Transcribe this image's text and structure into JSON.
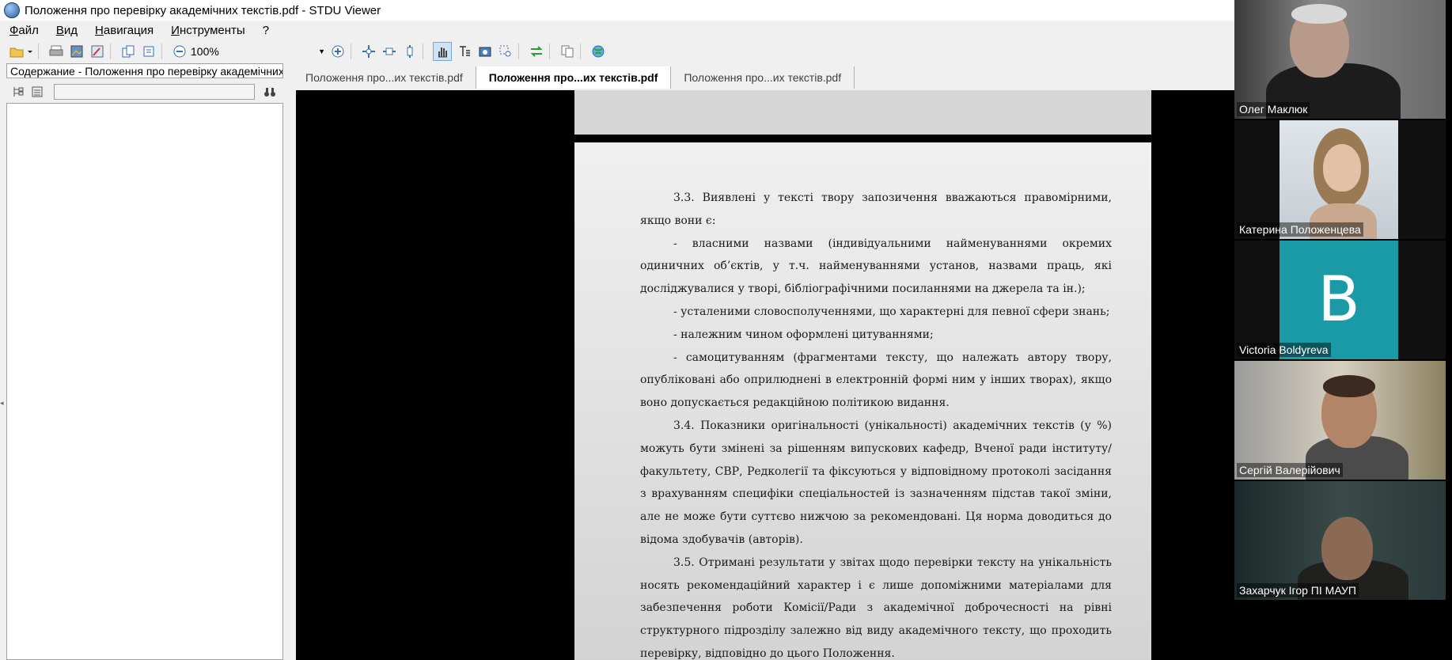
{
  "window": {
    "title": "Положення про перевірку академічних текстів.pdf - STDU Viewer"
  },
  "menu": [
    "Файл",
    "Вид",
    "Навигация",
    "Инструменты",
    "?"
  ],
  "toolbar": {
    "zoom": "100%"
  },
  "sidebar": {
    "header": "Содержание - Положення про перевірку академічних текстів.pdf"
  },
  "tabs": [
    {
      "label": "Положення про...их текстів.pdf"
    },
    {
      "label": "Положення про...их текстів.pdf"
    },
    {
      "label": "Положення про...их текстів.pdf"
    }
  ],
  "document": {
    "paragraphs": [
      "3.3. Виявлені у тексті твору запозичення вважаються правомірними, якщо вони є:",
      "- власними назвами (індивідуальними найменуваннями окремих одиничних об’єктів, у т.ч. найменуваннями установ, назвами праць, які досліджувалися у творі, бібліографічними посиланнями на джерела та ін.);",
      "- усталеними словосполученнями, що характерні для певної сфери знань;",
      "- належним чином оформлені цитуваннями;",
      "- самоцитуванням (фрагментами тексту, що належать автору твору, опубліковані або оприлюднені в електронній формі ним у інших творах), якщо воно допускається редакційною політикою видання.",
      "3.4. Показники оригінальності (унікальності) академічних текстів (у %) можуть бути змінені за рішенням випускових кафедр, Вченої ради інституту/факультету, СВР, Редколегії та фіксуються у відповідному протоколі засідання з врахуванням специфіки спеціальностей із зазначенням підстав такої зміни, але не може бути суттєво нижчою за рекомендовані. Ця норма доводиться до відома здобувачів (авторів).",
      "3.5. Отримані результати у звітах щодо перевірки тексту на унікальність носять рекомендаційний характер і є лише допоміжними матеріалами для забезпечення роботи Комісії/Ради з академічної доброчесності на рівні структурного підрозділу залежно від виду академічного тексту, що проходить перевірку, відповідно до цього Положення."
    ]
  },
  "participants": [
    {
      "name": "Олег Маклюк"
    },
    {
      "name": "Катерина Положенцева"
    },
    {
      "name": "Victoria Boldyreva",
      "initial": "B"
    },
    {
      "name": "Сергій Валерійович"
    },
    {
      "name": "Захарчук Ігор ПІ МАУП"
    }
  ],
  "colors": {
    "avatar_bg": "#1a9aa6",
    "active_tab_bg": "#ffffff",
    "viewer_bg": "#000000"
  }
}
